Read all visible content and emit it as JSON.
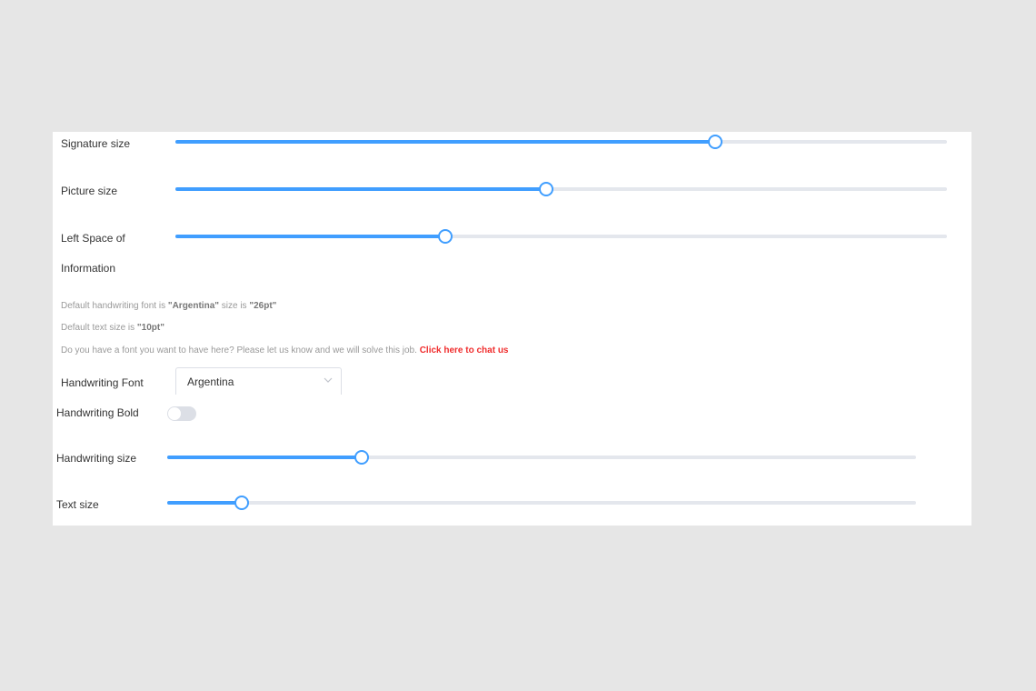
{
  "settings": {
    "signature_size": {
      "label": "Signature size",
      "value_fraction": 0.7
    },
    "picture_size": {
      "label": "Picture size",
      "value_fraction": 0.48
    },
    "left_space": {
      "label_line1": "Left Space of",
      "label_line2": "Information",
      "value_fraction": 0.35
    },
    "notes": {
      "line1_prefix": "Default handwriting font is ",
      "line1_font": "\"Argentina\"",
      "line1_middle": " size is ",
      "line1_size": "\"26pt\"",
      "line2_prefix": "Default text size is ",
      "line2_size": "\"10pt\"",
      "line3_text": "Do you have a font you want to have here? Please let us know and we will solve this job. ",
      "line3_link": "Click here to chat us"
    },
    "handwriting_font": {
      "label": "Handwriting Font",
      "selected": "Argentina",
      "icon": "chevron-down-icon"
    },
    "handwriting_bold": {
      "label": "Handwriting Bold",
      "enabled": false
    },
    "handwriting_size": {
      "label": "Handwriting size",
      "value_fraction": 0.26
    },
    "text_size": {
      "label": "Text size",
      "value_fraction": 0.1
    }
  },
  "colors": {
    "accent": "#409eff",
    "track": "#e4e7ed",
    "link": "#f02d2d",
    "muted_text": "#999999"
  }
}
